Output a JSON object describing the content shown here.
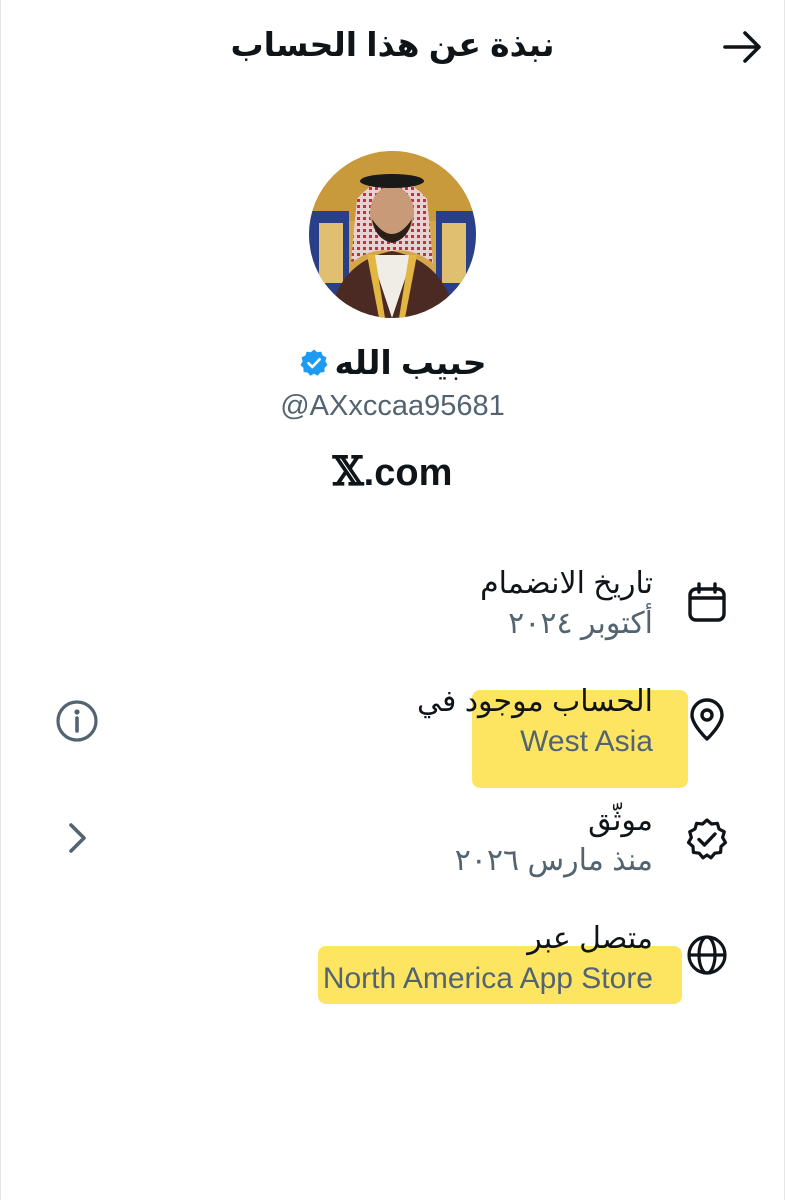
{
  "header": {
    "title": "نبذة عن هذا الحساب",
    "back_icon": "arrow-right-icon"
  },
  "profile": {
    "display_name": "حبيب الله",
    "handle": "@AXxccaa95681",
    "verified_color": "#1d9bf0",
    "brand_logo": "𝕏",
    "brand_text": ".com"
  },
  "info": {
    "joined": {
      "title": "تاريخ الانضمام",
      "value": "أكتوبر ٢٠٢٤",
      "icon": "calendar-icon"
    },
    "location": {
      "title": "الحساب موجود في",
      "value": "West Asia",
      "icon": "location-pin-icon",
      "side_icon": "info-icon"
    },
    "verified": {
      "title": "موثّق",
      "value": "منذ مارس ٢٠٢٦",
      "icon": "verified-badge-icon",
      "side_icon": "chevron-left-icon"
    },
    "connected": {
      "title": "متصل عبر",
      "value": "North America App Store",
      "icon": "globe-icon"
    }
  },
  "colors": {
    "text_primary": "#0f1419",
    "text_secondary": "#536471",
    "highlight": "#fde047"
  }
}
